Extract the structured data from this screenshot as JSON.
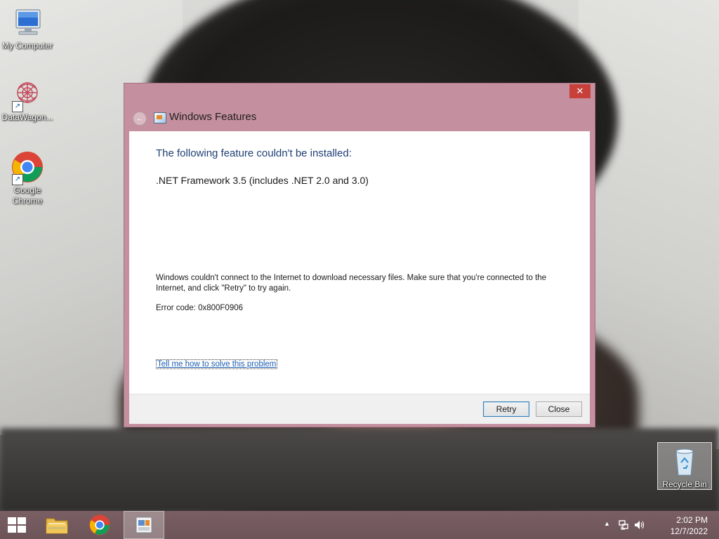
{
  "desktop": {
    "icons": [
      {
        "label": "My Computer",
        "icon": "computer-icon"
      },
      {
        "label": "DataWagon...",
        "icon": "datawagon-icon"
      },
      {
        "label": "Google\nChrome",
        "icon": "chrome-icon"
      },
      {
        "label": "Recycle Bin",
        "icon": "recycle-bin-icon"
      }
    ]
  },
  "dialog": {
    "title": "Windows Features",
    "close_symbol": "✕",
    "back_symbol": "←",
    "heading": "The following feature couldn't be installed:",
    "feature": ".NET Framework 3.5 (includes .NET 2.0 and 3.0)",
    "message": "Windows couldn't connect to the Internet to download necessary files. Make sure that you're connected to the Internet, and click \"Retry\" to try again.",
    "error_code": "Error code: 0x800F0906",
    "help_link": "Tell me how to solve this problem",
    "buttons": {
      "retry": "Retry",
      "close": "Close"
    }
  },
  "taskbar": {
    "apps": [
      "start-icon",
      "file-explorer-icon",
      "chrome-icon",
      "windows-features-icon"
    ],
    "tray": {
      "show_hidden_symbol": "▲",
      "time": "2:02 PM",
      "date": "12/7/2022"
    }
  },
  "colors": {
    "dialog_frame": "#c48f9f",
    "close_button": "#c7413a",
    "heading_text": "#1f3f74",
    "link_text": "#1a5db0",
    "taskbar": "#7a5f63"
  }
}
